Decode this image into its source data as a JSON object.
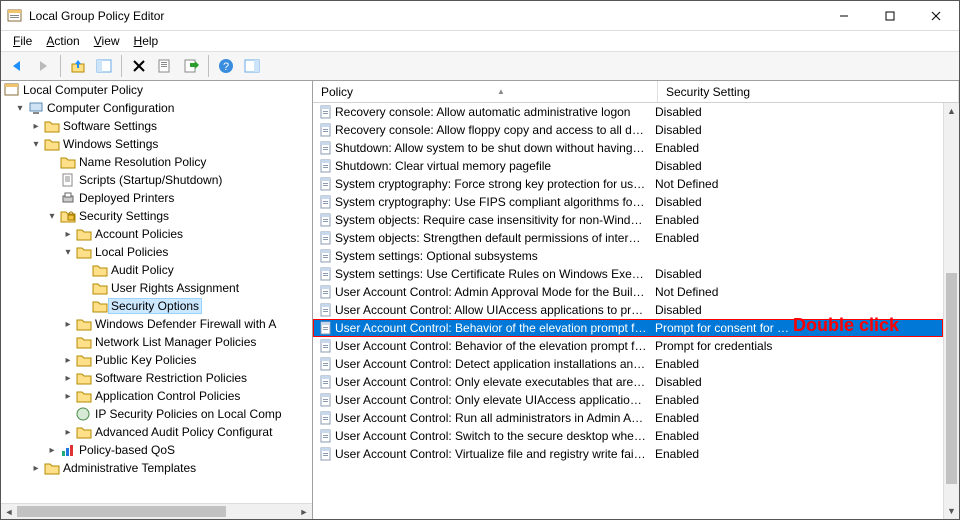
{
  "window": {
    "title": "Local Group Policy Editor"
  },
  "menubar": {
    "file": "File",
    "action": "Action",
    "view": "View",
    "help": "Help"
  },
  "toolbar_icons": {
    "back": "back-arrow",
    "forward": "forward-arrow",
    "up": "up-folder",
    "show_hide": "show-hide-tree",
    "delete": "delete",
    "properties": "properties",
    "export": "export-list",
    "help": "help",
    "extra": "action-pane"
  },
  "tree": {
    "root": "Local Computer Policy",
    "computer_configuration": "Computer Configuration",
    "software_settings": "Software Settings",
    "windows_settings": "Windows Settings",
    "name_resolution_policy": "Name Resolution Policy",
    "scripts": "Scripts (Startup/Shutdown)",
    "deployed_printers": "Deployed Printers",
    "security_settings": "Security Settings",
    "account_policies": "Account Policies",
    "local_policies": "Local Policies",
    "audit_policy": "Audit Policy",
    "user_rights_assignment": "User Rights Assignment",
    "security_options": "Security Options",
    "wdf": "Windows Defender Firewall with A",
    "nlmp": "Network List Manager Policies",
    "pkp": "Public Key Policies",
    "srp": "Software Restriction Policies",
    "acp": "Application Control Policies",
    "ipsec": "IP Security Policies on Local Comp",
    "aapc": "Advanced Audit Policy Configurat",
    "pbqos": "Policy-based QoS",
    "admin_templates": "Administrative Templates"
  },
  "columns": {
    "policy": "Policy",
    "setting": "Security Setting"
  },
  "rows": [
    {
      "policy": "Recovery console: Allow automatic administrative logon",
      "setting": "Disabled"
    },
    {
      "policy": "Recovery console: Allow floppy copy and access to all drives…",
      "setting": "Disabled"
    },
    {
      "policy": "Shutdown: Allow system to be shut down without having to…",
      "setting": "Enabled"
    },
    {
      "policy": "Shutdown: Clear virtual memory pagefile",
      "setting": "Disabled"
    },
    {
      "policy": "System cryptography: Force strong key protection for user k…",
      "setting": "Not Defined"
    },
    {
      "policy": "System cryptography: Use FIPS compliant algorithms for en…",
      "setting": "Disabled"
    },
    {
      "policy": "System objects: Require case insensitivity for non-Windows …",
      "setting": "Enabled"
    },
    {
      "policy": "System objects: Strengthen default permissions of internal s…",
      "setting": "Enabled"
    },
    {
      "policy": "System settings: Optional subsystems",
      "setting": ""
    },
    {
      "policy": "System settings: Use Certificate Rules on Windows Executabl…",
      "setting": "Disabled"
    },
    {
      "policy": "User Account Control: Admin Approval Mode for the Built-i…",
      "setting": "Not Defined"
    },
    {
      "policy": "User Account Control: Allow UIAccess applications to prom…",
      "setting": "Disabled"
    },
    {
      "policy": "User Account Control: Behavior of the elevation prompt for …",
      "setting": "Prompt for consent for …",
      "selected": true
    },
    {
      "policy": "User Account Control: Behavior of the elevation prompt for …",
      "setting": "Prompt for credentials"
    },
    {
      "policy": "User Account Control: Detect application installations and p…",
      "setting": "Enabled"
    },
    {
      "policy": "User Account Control: Only elevate executables that are sign…",
      "setting": "Disabled"
    },
    {
      "policy": "User Account Control: Only elevate UIAccess applications th…",
      "setting": "Enabled"
    },
    {
      "policy": "User Account Control: Run all administrators in Admin Appr…",
      "setting": "Enabled"
    },
    {
      "policy": "User Account Control: Switch to the secure desktop when pr…",
      "setting": "Enabled"
    },
    {
      "policy": "User Account Control: Virtualize file and registry write failure…",
      "setting": "Enabled"
    }
  ],
  "annotation": {
    "text": "Double click"
  }
}
